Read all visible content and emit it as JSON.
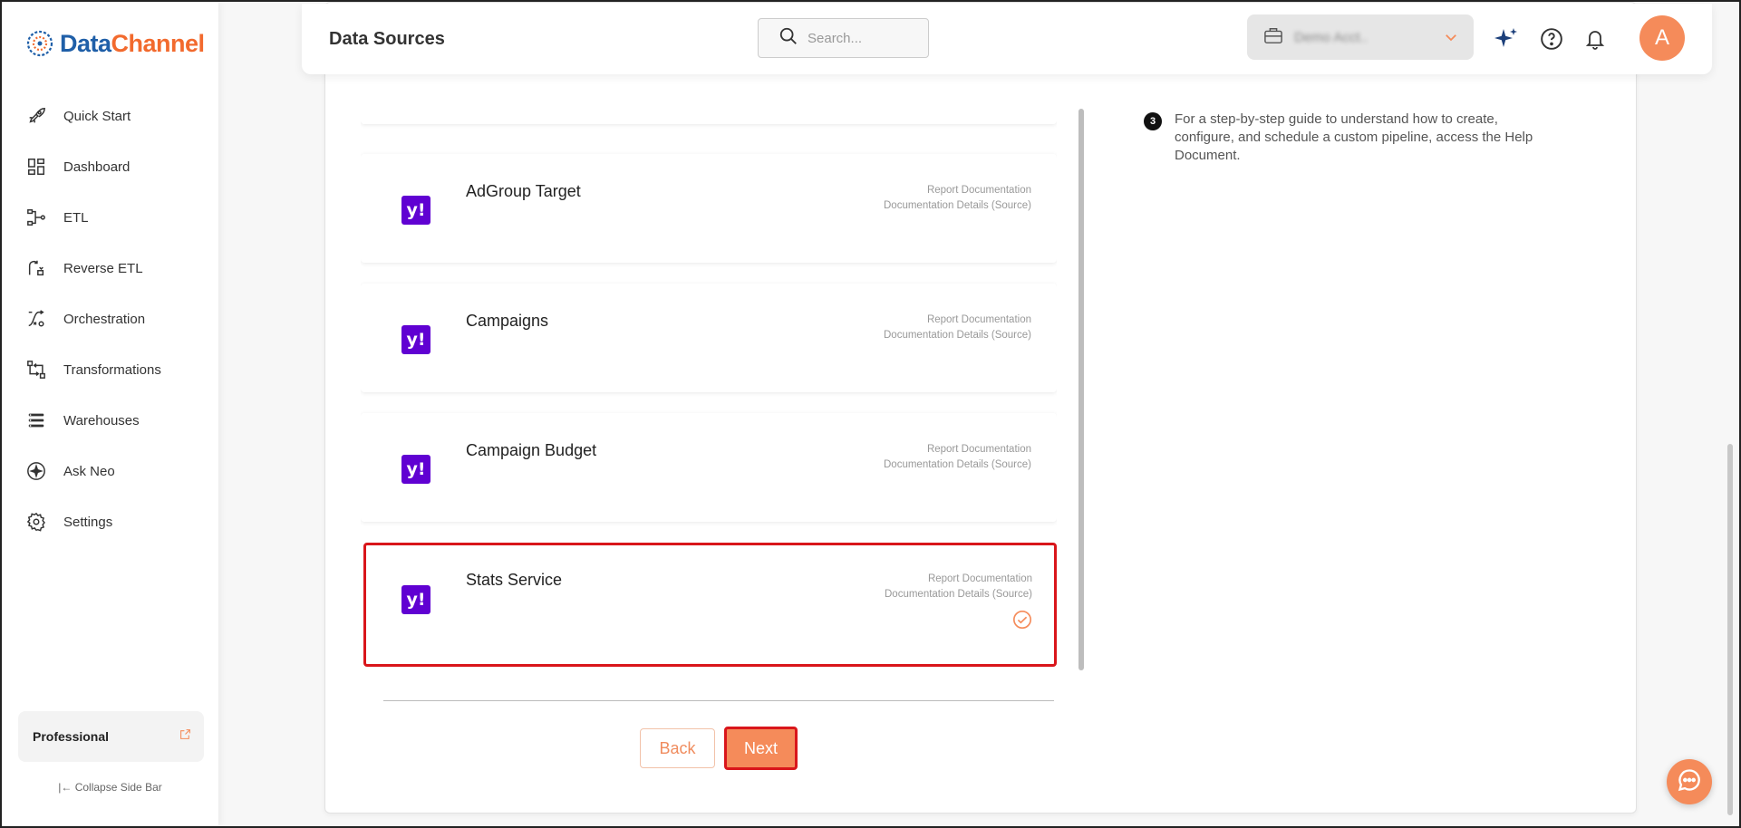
{
  "brand": {
    "part1": "Data",
    "part2": "Channel"
  },
  "sidebar": {
    "items": [
      {
        "label": "Quick Start",
        "icon": "rocket-icon"
      },
      {
        "label": "Dashboard",
        "icon": "dashboard-icon"
      },
      {
        "label": "ETL",
        "icon": "etl-icon"
      },
      {
        "label": "Reverse ETL",
        "icon": "reverse-etl-icon"
      },
      {
        "label": "Orchestration",
        "icon": "orchestration-icon"
      },
      {
        "label": "Transformations",
        "icon": "transformations-icon"
      },
      {
        "label": "Warehouses",
        "icon": "warehouses-icon"
      },
      {
        "label": "Ask Neo",
        "icon": "sparkle-icon"
      },
      {
        "label": "Settings",
        "icon": "gear-icon"
      }
    ],
    "plan": "Professional",
    "collapse": "Collapse Side Bar"
  },
  "header": {
    "title": "Data Sources",
    "search_placeholder": "Search...",
    "workspace": "Demo Acct..",
    "avatar": "A"
  },
  "reports": [
    {
      "title": "AdGroup Target",
      "link1": "Report Documentation",
      "link2": "Documentation Details (Source)",
      "selected": false
    },
    {
      "title": "Campaigns",
      "link1": "Report Documentation",
      "link2": "Documentation Details (Source)",
      "selected": false
    },
    {
      "title": "Campaign Budget",
      "link1": "Report Documentation",
      "link2": "Documentation Details (Source)",
      "selected": false
    },
    {
      "title": "Stats Service",
      "link1": "Report Documentation",
      "link2": "Documentation Details (Source)",
      "selected": true
    }
  ],
  "buttons": {
    "back": "Back",
    "next": "Next"
  },
  "tip": {
    "number": "3",
    "text": "For a step-by-step guide to understand how to create, configure, and schedule a custom pipeline, access the Help Document."
  },
  "colors": {
    "accent": "#f58b5a",
    "yahoo": "#6001d2",
    "highlight": "#d9161b",
    "brand_blue": "#1f5fa8",
    "brand_orange": "#f26a2e"
  }
}
